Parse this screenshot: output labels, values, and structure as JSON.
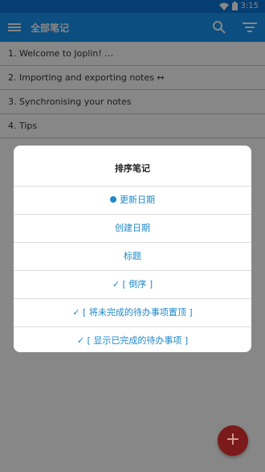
{
  "status_bar": {
    "time": "3:15"
  },
  "app_bar": {
    "title": "全部笔记"
  },
  "notes": [
    {
      "title": "1. Welcome to Joplin! …"
    },
    {
      "title": "2. Importing and exporting notes ↔"
    },
    {
      "title": "3. Synchronising your notes"
    },
    {
      "title": "4. Tips"
    }
  ],
  "sort_dialog": {
    "title": "排序笔记",
    "options": [
      {
        "label": "更新日期",
        "selected": true
      },
      {
        "label": "创建日期"
      },
      {
        "label": "标题"
      },
      {
        "label": "✓ [ 倒序 ]"
      },
      {
        "label": "✓ [ 将未完成的待办事项置顶 ]"
      },
      {
        "label": "✓ [ 显示已完成的待办事项 ]"
      }
    ]
  },
  "fab": {
    "label": "+"
  },
  "colors": {
    "status_bar": "#0a75d8",
    "app_bar": "#1593f0",
    "accent": "#1e88c8",
    "fab": "#7a1a1a"
  }
}
